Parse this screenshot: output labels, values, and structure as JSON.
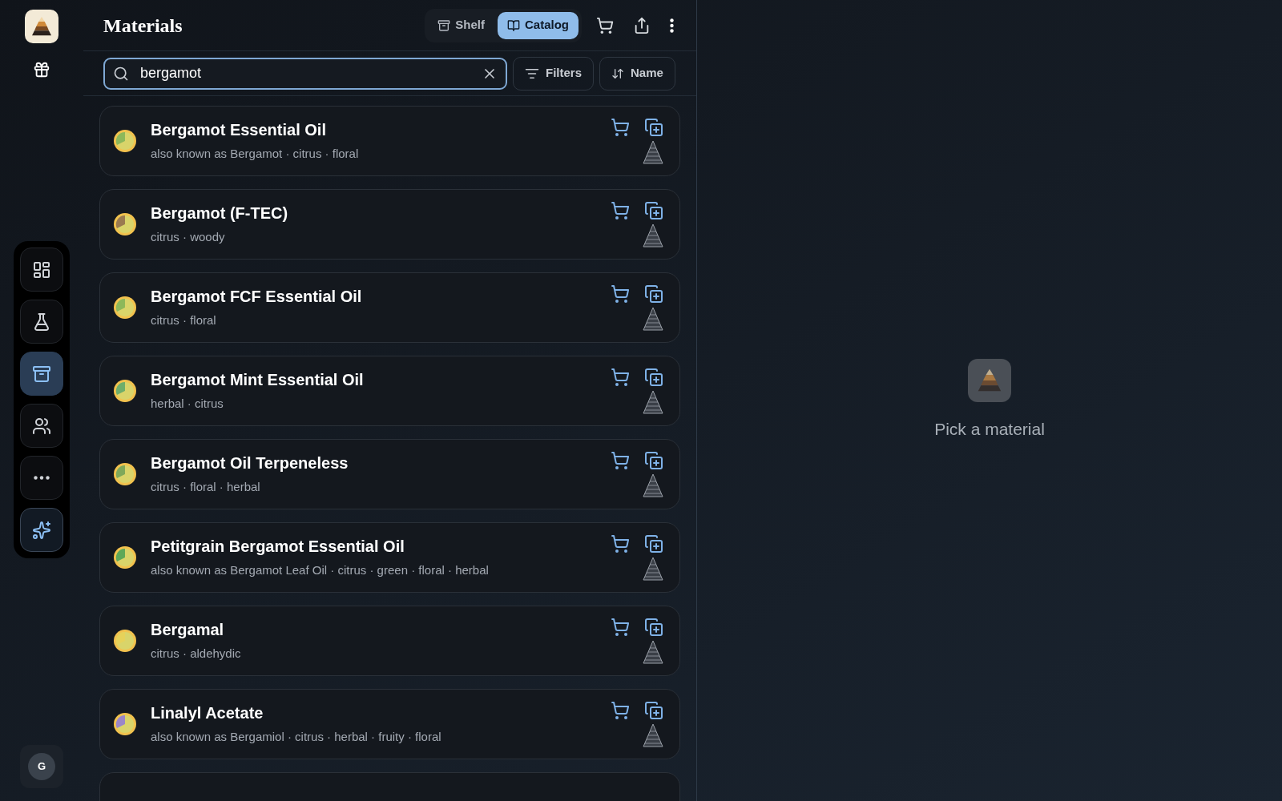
{
  "header": {
    "title": "Materials",
    "view_tabs": [
      {
        "label": "Shelf",
        "kind": "shelf",
        "selected": false
      },
      {
        "label": "Catalog",
        "kind": "catalog",
        "selected": true
      }
    ]
  },
  "search": {
    "value": "bergamot"
  },
  "toolbar": {
    "filters": "Filters",
    "sort": "Name"
  },
  "nav": [
    {
      "kind": "dashboard",
      "selected": false
    },
    {
      "kind": "flask",
      "selected": false
    },
    {
      "kind": "archive",
      "selected": true
    },
    {
      "kind": "people",
      "selected": false
    },
    {
      "kind": "more",
      "selected": false
    },
    {
      "kind": "sparkle",
      "selected": false
    }
  ],
  "user": {
    "initial": "G"
  },
  "materials": [
    {
      "name": "Bergamot Essential Oil",
      "subtitle": "also known as Bergamot · citrus · floral",
      "color": "#8db85a"
    },
    {
      "name": "Bergamot (F-TEC)",
      "subtitle": "citrus · woody",
      "color": "#9a7a50"
    },
    {
      "name": "Bergamot FCF Essential Oil",
      "subtitle": "citrus · floral",
      "color": "#8db85a"
    },
    {
      "name": "Bergamot Mint Essential Oil",
      "subtitle": "herbal · citrus",
      "color": "#6fae6a"
    },
    {
      "name": "Bergamot Oil Terpeneless",
      "subtitle": "citrus · floral · herbal",
      "color": "#7fa85a"
    },
    {
      "name": "Petitgrain Bergamot Essential Oil",
      "subtitle": "also known as Bergamot Leaf Oil · citrus · green · floral · herbal",
      "color": "#5fa858"
    },
    {
      "name": "Bergamal",
      "subtitle": "citrus · aldehydic",
      "color": "#e6d25a"
    },
    {
      "name": "Linalyl Acetate",
      "subtitle": "also known as Bergamiol · citrus · herbal · fruity · floral",
      "color": "#9a86c8"
    }
  ],
  "empty_state": {
    "message": "Pick a material"
  }
}
